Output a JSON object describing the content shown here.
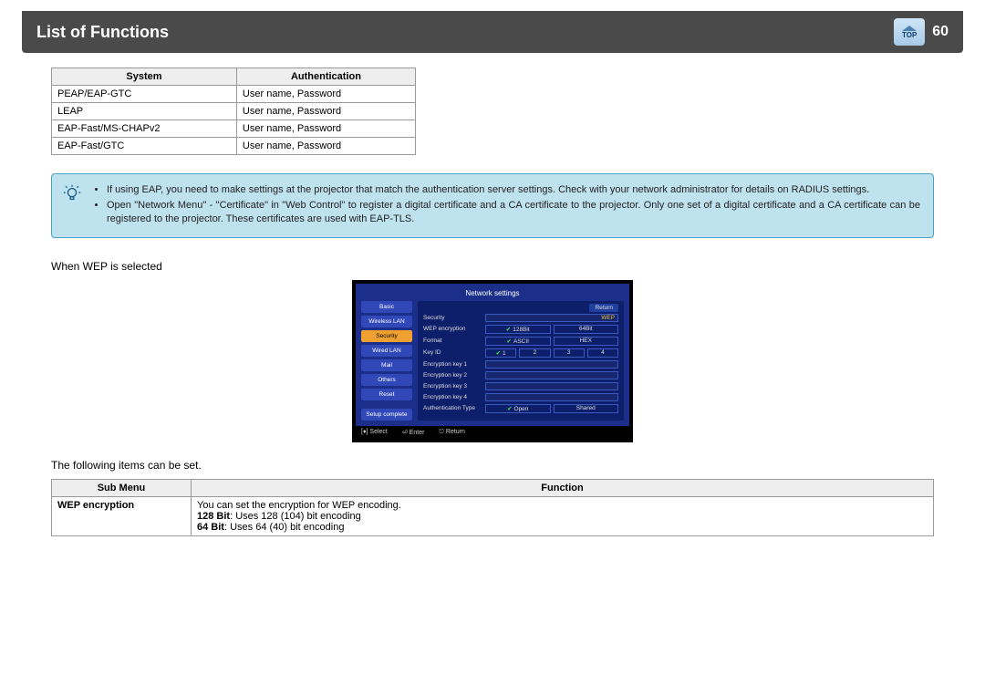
{
  "header": {
    "title": "List of Functions",
    "page": "60",
    "top_label": "TOP"
  },
  "auth_table": {
    "col1": "System",
    "col2": "Authentication",
    "rows": [
      {
        "sys": "PEAP/EAP-GTC",
        "auth": "User name, Password"
      },
      {
        "sys": "LEAP",
        "auth": "User name, Password"
      },
      {
        "sys": "EAP-Fast/MS-CHAPv2",
        "auth": "User name, Password"
      },
      {
        "sys": "EAP-Fast/GTC",
        "auth": "User name, Password"
      }
    ]
  },
  "info": {
    "item1": "If using EAP, you need to make settings at the projector that match the authentication server settings. Check with your network administrator for details on RADIUS settings.",
    "item2": "Open \"Network Menu\" - \"Certificate\" in \"Web Control\" to register a digital certificate and a CA certificate to the projector. Only one set of a digital certificate and a CA certificate can be registered to the projector. These certificates are used with EAP-TLS."
  },
  "wep": {
    "heading": "When WEP is selected",
    "following": "The following items can be set.",
    "ui": {
      "title": "Network settings",
      "return": "Return",
      "side": [
        "Basic",
        "Wireless LAN",
        "Security",
        "Wired LAN",
        "Mail",
        "Others",
        "Reset",
        "Setup complete"
      ],
      "rows": {
        "security_label": "Security",
        "security_value": "WEP",
        "wep_enc_label": "WEP encryption",
        "wep_enc_opt1": "128Bit",
        "wep_enc_opt2": "64Bit",
        "format_label": "Format",
        "format_opt1": "ASCII",
        "format_opt2": "HEX",
        "keyid_label": "Key ID",
        "keyid_opts": [
          "1",
          "2",
          "3",
          "4"
        ],
        "k1": "Encryption key 1",
        "k2": "Encryption key 2",
        "k3": "Encryption key 3",
        "k4": "Encryption key 4",
        "authtype_label": "Authentication Type",
        "authtype_opt1": "Open",
        "authtype_opt2": "Shared"
      },
      "footer": {
        "select": "Select",
        "enter": "Enter",
        "ret": "Return"
      }
    }
  },
  "func_table": {
    "col1": "Sub Menu",
    "col2": "Function",
    "row": {
      "sub": "WEP encryption",
      "line1": "You can set the encryption for WEP encoding.",
      "line2a": "128 Bit",
      "line2b": ": Uses 128 (104) bit encoding",
      "line3a": "64 Bit",
      "line3b": ": Uses 64 (40) bit encoding"
    }
  }
}
